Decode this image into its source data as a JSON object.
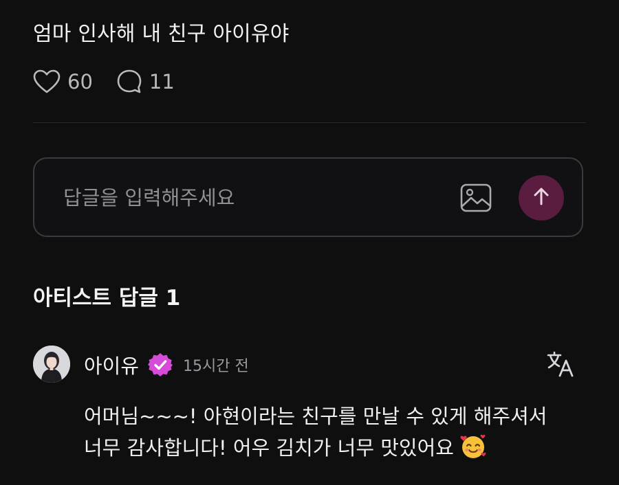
{
  "post": {
    "text": "엄마 인사해 내 친구 아이유야",
    "likes": "60",
    "comments": "11"
  },
  "reply": {
    "placeholder": "답글을 입력해주세요"
  },
  "artist_replies": {
    "title": "아티스트 답글 1",
    "items": [
      {
        "author": "아이유",
        "time": "15시간 전",
        "body": "어머님~~~! 아현이라는 친구를 만날 수 있게 해주셔서 너무 감사합니다! 어우 김치가 너무 맛있어요"
      }
    ]
  },
  "colors": {
    "background": "#0f0f10",
    "send_button": "#5a1c3f",
    "verified_badge": "#d64bd8"
  },
  "icons": {
    "like": "heart-icon",
    "comment": "speech-bubble-icon",
    "attach": "image-icon",
    "send": "arrow-up-icon",
    "verified": "verified-badge-icon",
    "translate": "translate-icon",
    "emoji": "smiling-face-with-hearts-icon"
  }
}
